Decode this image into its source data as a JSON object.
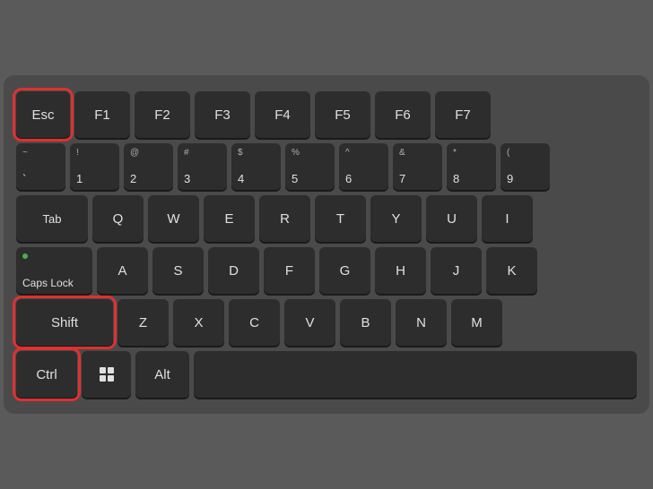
{
  "keyboard": {
    "rows": {
      "row1": {
        "keys": [
          "Esc",
          "F1",
          "F2",
          "F3",
          "F4",
          "F5",
          "F6",
          "F7"
        ]
      },
      "row2": {
        "keys": [
          {
            "top": "~",
            "bottom": "` "
          },
          {
            "top": "!",
            "bottom": "1"
          },
          {
            "top": "@",
            "bottom": "2"
          },
          {
            "top": "#",
            "bottom": "3"
          },
          {
            "top": "$",
            "bottom": "4"
          },
          {
            "top": "%",
            "bottom": "5"
          },
          {
            "top": "^",
            "bottom": "6"
          },
          {
            "top": "&",
            "bottom": "7"
          },
          {
            "top": "*",
            "bottom": "8"
          },
          {
            "top": "(",
            "bottom": "("
          }
        ]
      },
      "row3": {
        "keys": [
          "Tab",
          "Q",
          "W",
          "E",
          "R",
          "T",
          "Y",
          "U",
          "I"
        ]
      },
      "row4": {
        "keys": [
          "Caps Lock",
          "A",
          "S",
          "D",
          "F",
          "G",
          "H",
          "J",
          "K"
        ]
      },
      "row5": {
        "keys": [
          "Shift",
          "Z",
          "X",
          "C",
          "V",
          "B",
          "N",
          "M"
        ]
      },
      "row6": {
        "keys": [
          "Ctrl",
          "Win",
          "Alt",
          "Space"
        ]
      }
    }
  }
}
